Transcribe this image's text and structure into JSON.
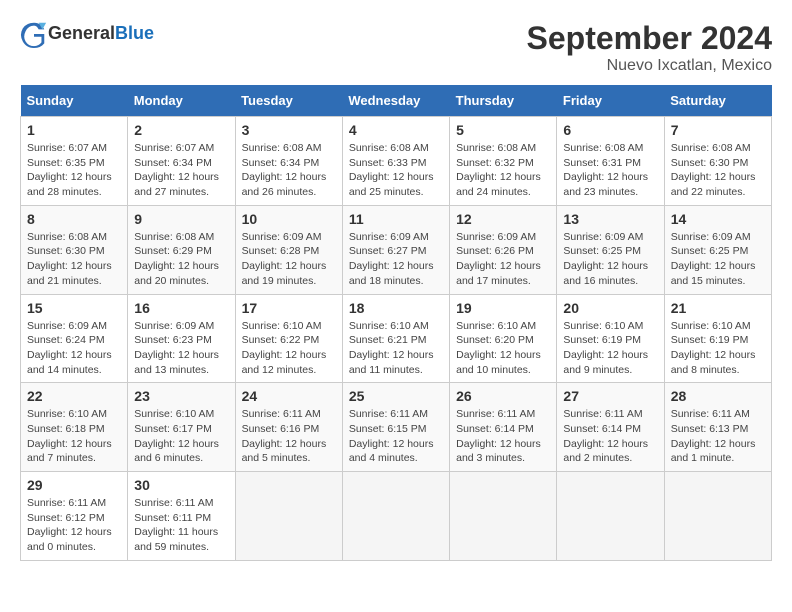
{
  "header": {
    "logo_general": "General",
    "logo_blue": "Blue",
    "month": "September 2024",
    "location": "Nuevo Ixcatlan, Mexico"
  },
  "weekdays": [
    "Sunday",
    "Monday",
    "Tuesday",
    "Wednesday",
    "Thursday",
    "Friday",
    "Saturday"
  ],
  "weeks": [
    [
      {
        "day": "1",
        "lines": [
          "Sunrise: 6:07 AM",
          "Sunset: 6:35 PM",
          "Daylight: 12 hours",
          "and 28 minutes."
        ]
      },
      {
        "day": "2",
        "lines": [
          "Sunrise: 6:07 AM",
          "Sunset: 6:34 PM",
          "Daylight: 12 hours",
          "and 27 minutes."
        ]
      },
      {
        "day": "3",
        "lines": [
          "Sunrise: 6:08 AM",
          "Sunset: 6:34 PM",
          "Daylight: 12 hours",
          "and 26 minutes."
        ]
      },
      {
        "day": "4",
        "lines": [
          "Sunrise: 6:08 AM",
          "Sunset: 6:33 PM",
          "Daylight: 12 hours",
          "and 25 minutes."
        ]
      },
      {
        "day": "5",
        "lines": [
          "Sunrise: 6:08 AM",
          "Sunset: 6:32 PM",
          "Daylight: 12 hours",
          "and 24 minutes."
        ]
      },
      {
        "day": "6",
        "lines": [
          "Sunrise: 6:08 AM",
          "Sunset: 6:31 PM",
          "Daylight: 12 hours",
          "and 23 minutes."
        ]
      },
      {
        "day": "7",
        "lines": [
          "Sunrise: 6:08 AM",
          "Sunset: 6:30 PM",
          "Daylight: 12 hours",
          "and 22 minutes."
        ]
      }
    ],
    [
      {
        "day": "8",
        "lines": [
          "Sunrise: 6:08 AM",
          "Sunset: 6:30 PM",
          "Daylight: 12 hours",
          "and 21 minutes."
        ]
      },
      {
        "day": "9",
        "lines": [
          "Sunrise: 6:08 AM",
          "Sunset: 6:29 PM",
          "Daylight: 12 hours",
          "and 20 minutes."
        ]
      },
      {
        "day": "10",
        "lines": [
          "Sunrise: 6:09 AM",
          "Sunset: 6:28 PM",
          "Daylight: 12 hours",
          "and 19 minutes."
        ]
      },
      {
        "day": "11",
        "lines": [
          "Sunrise: 6:09 AM",
          "Sunset: 6:27 PM",
          "Daylight: 12 hours",
          "and 18 minutes."
        ]
      },
      {
        "day": "12",
        "lines": [
          "Sunrise: 6:09 AM",
          "Sunset: 6:26 PM",
          "Daylight: 12 hours",
          "and 17 minutes."
        ]
      },
      {
        "day": "13",
        "lines": [
          "Sunrise: 6:09 AM",
          "Sunset: 6:25 PM",
          "Daylight: 12 hours",
          "and 16 minutes."
        ]
      },
      {
        "day": "14",
        "lines": [
          "Sunrise: 6:09 AM",
          "Sunset: 6:25 PM",
          "Daylight: 12 hours",
          "and 15 minutes."
        ]
      }
    ],
    [
      {
        "day": "15",
        "lines": [
          "Sunrise: 6:09 AM",
          "Sunset: 6:24 PM",
          "Daylight: 12 hours",
          "and 14 minutes."
        ]
      },
      {
        "day": "16",
        "lines": [
          "Sunrise: 6:09 AM",
          "Sunset: 6:23 PM",
          "Daylight: 12 hours",
          "and 13 minutes."
        ]
      },
      {
        "day": "17",
        "lines": [
          "Sunrise: 6:10 AM",
          "Sunset: 6:22 PM",
          "Daylight: 12 hours",
          "and 12 minutes."
        ]
      },
      {
        "day": "18",
        "lines": [
          "Sunrise: 6:10 AM",
          "Sunset: 6:21 PM",
          "Daylight: 12 hours",
          "and 11 minutes."
        ]
      },
      {
        "day": "19",
        "lines": [
          "Sunrise: 6:10 AM",
          "Sunset: 6:20 PM",
          "Daylight: 12 hours",
          "and 10 minutes."
        ]
      },
      {
        "day": "20",
        "lines": [
          "Sunrise: 6:10 AM",
          "Sunset: 6:19 PM",
          "Daylight: 12 hours",
          "and 9 minutes."
        ]
      },
      {
        "day": "21",
        "lines": [
          "Sunrise: 6:10 AM",
          "Sunset: 6:19 PM",
          "Daylight: 12 hours",
          "and 8 minutes."
        ]
      }
    ],
    [
      {
        "day": "22",
        "lines": [
          "Sunrise: 6:10 AM",
          "Sunset: 6:18 PM",
          "Daylight: 12 hours",
          "and 7 minutes."
        ]
      },
      {
        "day": "23",
        "lines": [
          "Sunrise: 6:10 AM",
          "Sunset: 6:17 PM",
          "Daylight: 12 hours",
          "and 6 minutes."
        ]
      },
      {
        "day": "24",
        "lines": [
          "Sunrise: 6:11 AM",
          "Sunset: 6:16 PM",
          "Daylight: 12 hours",
          "and 5 minutes."
        ]
      },
      {
        "day": "25",
        "lines": [
          "Sunrise: 6:11 AM",
          "Sunset: 6:15 PM",
          "Daylight: 12 hours",
          "and 4 minutes."
        ]
      },
      {
        "day": "26",
        "lines": [
          "Sunrise: 6:11 AM",
          "Sunset: 6:14 PM",
          "Daylight: 12 hours",
          "and 3 minutes."
        ]
      },
      {
        "day": "27",
        "lines": [
          "Sunrise: 6:11 AM",
          "Sunset: 6:14 PM",
          "Daylight: 12 hours",
          "and 2 minutes."
        ]
      },
      {
        "day": "28",
        "lines": [
          "Sunrise: 6:11 AM",
          "Sunset: 6:13 PM",
          "Daylight: 12 hours",
          "and 1 minute."
        ]
      }
    ],
    [
      {
        "day": "29",
        "lines": [
          "Sunrise: 6:11 AM",
          "Sunset: 6:12 PM",
          "Daylight: 12 hours",
          "and 0 minutes."
        ]
      },
      {
        "day": "30",
        "lines": [
          "Sunrise: 6:11 AM",
          "Sunset: 6:11 PM",
          "Daylight: 11 hours",
          "and 59 minutes."
        ]
      },
      {
        "day": "",
        "lines": []
      },
      {
        "day": "",
        "lines": []
      },
      {
        "day": "",
        "lines": []
      },
      {
        "day": "",
        "lines": []
      },
      {
        "day": "",
        "lines": []
      }
    ]
  ]
}
